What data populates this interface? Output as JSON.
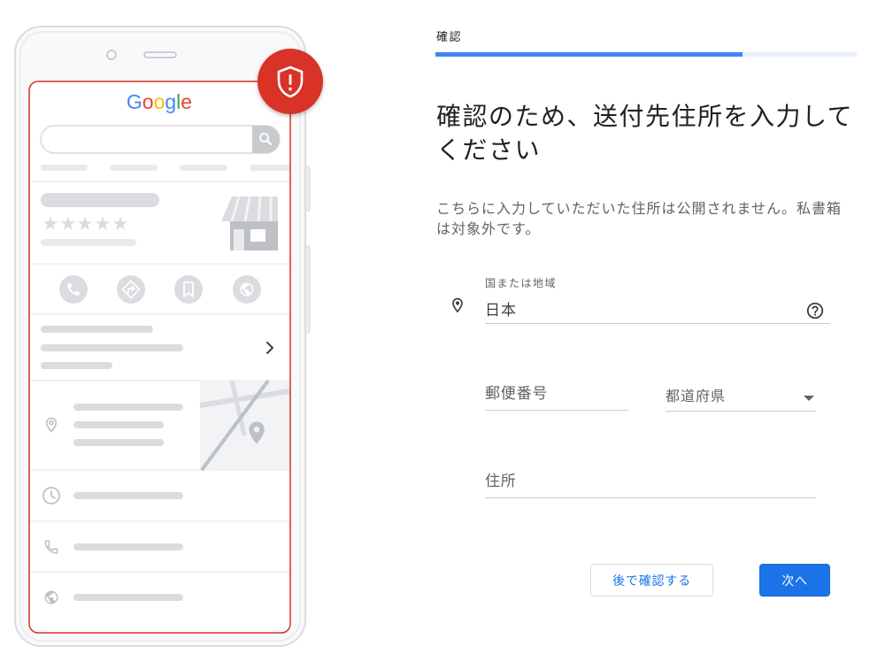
{
  "illustration": {
    "logo_letters": [
      {
        "ch": "G",
        "color": "#4285f4"
      },
      {
        "ch": "o",
        "color": "#ea4335"
      },
      {
        "ch": "o",
        "color": "#fbbc05"
      },
      {
        "ch": "g",
        "color": "#4285f4"
      },
      {
        "ch": "l",
        "color": "#34a853"
      },
      {
        "ch": "e",
        "color": "#ea4335"
      }
    ],
    "badge_icon": "shield-alert-icon",
    "search_icon": "search-icon",
    "action_icons": [
      "call-icon",
      "directions-icon",
      "bookmark-icon",
      "globe-icon"
    ],
    "info_icons": [
      "location-pin-icon",
      "clock-icon",
      "phone-icon",
      "globe-icon"
    ]
  },
  "step": {
    "label": "確認",
    "progress": 0.73
  },
  "title_lines": [
    "確認のため、送付先住所を入力して",
    "ください"
  ],
  "description_lines": [
    "こちらに入力していただいた住所は公開されません。私書箱",
    "は対象外です。"
  ],
  "form": {
    "country": {
      "label": "国または地域",
      "value": "日本",
      "icon": "location-pin-icon",
      "help_icon": "help-circle-icon"
    },
    "postal_code": {
      "placeholder": "郵便番号"
    },
    "prefecture": {
      "placeholder": "都道府県",
      "icon": "dropdown-arrow-icon"
    },
    "address": {
      "placeholder": "住所"
    }
  },
  "buttons": {
    "verify_later": "後で確認する",
    "next": "次へ"
  },
  "colors": {
    "accent": "#1a73e8",
    "progress_fill": "#4285f4",
    "progress_track": "#e8f0fe",
    "alert": "#d93025"
  }
}
